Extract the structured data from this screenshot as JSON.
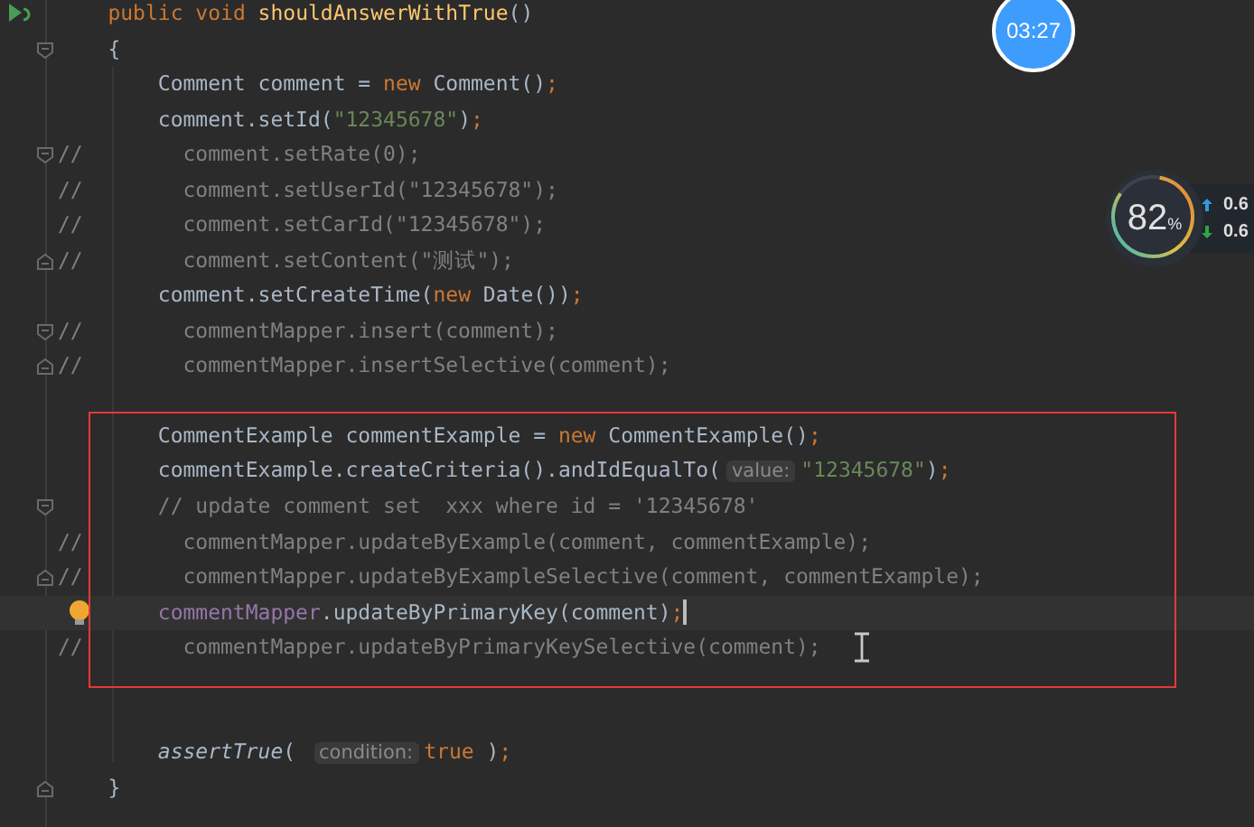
{
  "editor": {
    "lines": [
      {
        "fold_start": false,
        "fold_end": false,
        "runnable": true,
        "intention": false,
        "current": false,
        "tokens": [
          {
            "kind": "keyword",
            "text": "    public void "
          },
          {
            "kind": "method",
            "text": "shouldAnswerWithTrue"
          },
          {
            "kind": "plain",
            "text": "()"
          }
        ]
      },
      {
        "fold_start": true,
        "fold_end": false,
        "runnable": false,
        "intention": false,
        "current": false,
        "tokens": [
          {
            "kind": "plain",
            "text": "    {"
          }
        ]
      },
      {
        "fold_start": false,
        "fold_end": false,
        "runnable": false,
        "intention": false,
        "current": false,
        "tokens": [
          {
            "kind": "plain",
            "text": "        Comment comment = "
          },
          {
            "kind": "keyword",
            "text": "new "
          },
          {
            "kind": "plain",
            "text": "Comment()"
          },
          {
            "kind": "keyword",
            "text": ";"
          }
        ]
      },
      {
        "fold_start": false,
        "fold_end": false,
        "runnable": false,
        "intention": false,
        "current": false,
        "tokens": [
          {
            "kind": "plain",
            "text": "        comment.setId("
          },
          {
            "kind": "string",
            "text": "\"12345678\""
          },
          {
            "kind": "plain",
            "text": ")"
          },
          {
            "kind": "keyword",
            "text": ";"
          }
        ]
      },
      {
        "fold_start": true,
        "fold_end": false,
        "runnable": false,
        "intention": false,
        "current": false,
        "tokens": [
          {
            "kind": "comment",
            "text": "//        comment.setRate(0);"
          }
        ]
      },
      {
        "fold_start": false,
        "fold_end": false,
        "runnable": false,
        "intention": false,
        "current": false,
        "tokens": [
          {
            "kind": "comment",
            "text": "//        comment.setUserId(\"12345678\");"
          }
        ]
      },
      {
        "fold_start": false,
        "fold_end": false,
        "runnable": false,
        "intention": false,
        "current": false,
        "tokens": [
          {
            "kind": "comment",
            "text": "//        comment.setCarId(\"12345678\");"
          }
        ]
      },
      {
        "fold_start": false,
        "fold_end": true,
        "runnable": false,
        "intention": false,
        "current": false,
        "tokens": [
          {
            "kind": "comment",
            "text": "//        comment.setContent(\"测试\");"
          }
        ]
      },
      {
        "fold_start": false,
        "fold_end": false,
        "runnable": false,
        "intention": false,
        "current": false,
        "tokens": [
          {
            "kind": "plain",
            "text": "        comment.setCreateTime("
          },
          {
            "kind": "keyword",
            "text": "new "
          },
          {
            "kind": "plain",
            "text": "Date())"
          },
          {
            "kind": "keyword",
            "text": ";"
          }
        ]
      },
      {
        "fold_start": true,
        "fold_end": false,
        "runnable": false,
        "intention": false,
        "current": false,
        "tokens": [
          {
            "kind": "comment",
            "text": "//        commentMapper.insert(comment);"
          }
        ]
      },
      {
        "fold_start": false,
        "fold_end": true,
        "runnable": false,
        "intention": false,
        "current": false,
        "tokens": [
          {
            "kind": "comment",
            "text": "//        commentMapper.insertSelective(comment);"
          }
        ]
      },
      {
        "fold_start": false,
        "fold_end": false,
        "runnable": false,
        "intention": false,
        "current": false
      },
      {
        "fold_start": false,
        "fold_end": false,
        "runnable": false,
        "intention": false,
        "current": false,
        "tokens": [
          {
            "kind": "plain",
            "text": "        CommentExample commentExample = "
          },
          {
            "kind": "keyword",
            "text": "new "
          },
          {
            "kind": "plain",
            "text": "CommentExample()"
          },
          {
            "kind": "keyword",
            "text": ";"
          }
        ]
      },
      {
        "fold_start": false,
        "fold_end": false,
        "runnable": false,
        "intention": false,
        "current": false,
        "tokens": [
          {
            "kind": "plain",
            "text": "        commentExample.createCriteria().andIdEqualTo("
          },
          {
            "kind": "hint",
            "text": "value:"
          },
          {
            "kind": "string",
            "text": "\"12345678\""
          },
          {
            "kind": "plain",
            "text": ")"
          },
          {
            "kind": "keyword",
            "text": ";"
          }
        ]
      },
      {
        "fold_start": true,
        "fold_end": false,
        "runnable": false,
        "intention": false,
        "current": false,
        "tokens": [
          {
            "kind": "comment",
            "text": "        // update comment set  xxx where id = '12345678'"
          }
        ]
      },
      {
        "fold_start": false,
        "fold_end": false,
        "runnable": false,
        "intention": false,
        "current": false,
        "tokens": [
          {
            "kind": "comment",
            "text": "//        commentMapper.updateByExample(comment, commentExample);"
          }
        ]
      },
      {
        "fold_start": false,
        "fold_end": true,
        "runnable": false,
        "intention": false,
        "current": false,
        "tokens": [
          {
            "kind": "comment",
            "text": "//        commentMapper.updateByExampleSelective(comment, commentExample);"
          }
        ]
      },
      {
        "fold_start": false,
        "fold_end": false,
        "runnable": false,
        "intention": true,
        "current": true,
        "tokens": [
          {
            "kind": "field",
            "text": "        commentMapper"
          },
          {
            "kind": "plain",
            "text": ".updateByPrimaryKey(comment)"
          },
          {
            "kind": "keyword",
            "text": ";"
          }
        ]
      },
      {
        "fold_start": false,
        "fold_end": false,
        "runnable": false,
        "intention": false,
        "current": false,
        "tokens": [
          {
            "kind": "comment",
            "text": "//        commentMapper.updateByPrimaryKeySelective(comment);"
          }
        ]
      },
      {
        "fold_start": false,
        "fold_end": false,
        "runnable": false,
        "intention": false,
        "current": false
      },
      {
        "fold_start": false,
        "fold_end": false,
        "runnable": false,
        "intention": false,
        "current": false
      },
      {
        "fold_start": false,
        "fold_end": false,
        "runnable": false,
        "intention": false,
        "current": false,
        "tokens": [
          {
            "kind": "italic",
            "text": "        assertTrue"
          },
          {
            "kind": "plain",
            "text": "( "
          },
          {
            "kind": "hint",
            "text": "condition:"
          },
          {
            "kind": "keyword",
            "text": "true"
          },
          {
            "kind": "plain",
            "text": " )"
          },
          {
            "kind": "keyword",
            "text": ";"
          }
        ]
      },
      {
        "fold_start": false,
        "fold_end": true,
        "runnable": false,
        "intention": false,
        "current": false,
        "tokens": [
          {
            "kind": "plain",
            "text": "    }"
          }
        ]
      }
    ]
  },
  "clock_widget": {
    "time": "03:27"
  },
  "system_meter": {
    "percent": "82",
    "unit": "%",
    "upload": "0.6",
    "download": "0.6"
  }
}
